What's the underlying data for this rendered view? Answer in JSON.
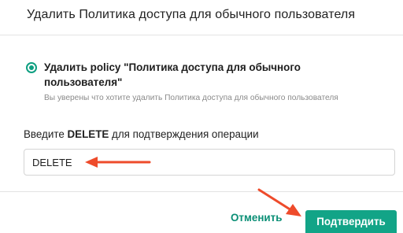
{
  "dialog": {
    "title": "Удалить Политика доступа для обычного пользователя"
  },
  "option": {
    "title": "Удалить policy \"Политика доступа для обычного пользователя\"",
    "description": "Вы уверены что хотите удалить Политика доступа для обычного пользователя",
    "selected": true
  },
  "confirmation": {
    "label_prefix": "Введите ",
    "label_keyword": "DELETE",
    "label_suffix": " для подтверждения операции",
    "input_value": "DELETE"
  },
  "buttons": {
    "cancel_label": "Отменить",
    "confirm_label": "Подтвердить"
  },
  "colors": {
    "accent": "#12a487",
    "annotation_arrow": "#ee4b2b"
  },
  "annotations": [
    {
      "icon": "arrow-icon",
      "target": "confirm-input"
    },
    {
      "icon": "arrow-icon",
      "target": "confirm-button"
    }
  ]
}
